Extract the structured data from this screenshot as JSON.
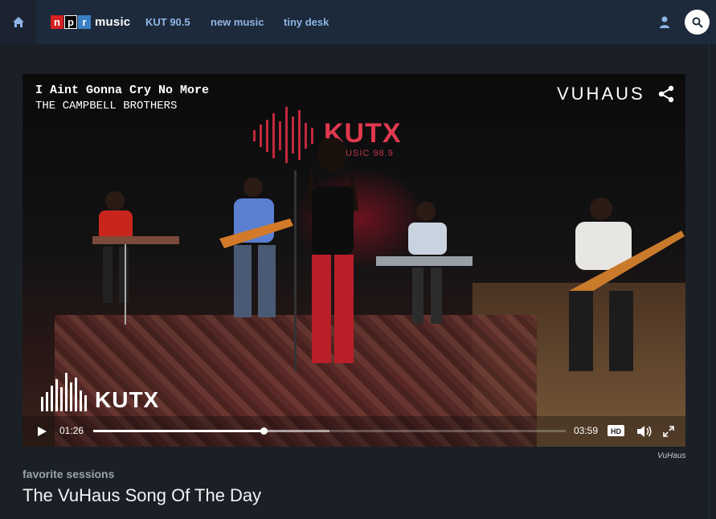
{
  "header": {
    "logo": {
      "n": "n",
      "p": "p",
      "r": "r",
      "music": "music"
    },
    "nav": [
      "KUT 90.5",
      "new music",
      "tiny desk"
    ],
    "icons": {
      "home": "home-icon",
      "user": "user-icon",
      "search": "search-icon"
    }
  },
  "video": {
    "song_title": "I Aint Gonna Cry No More",
    "artist": "THE CAMPBELL BROTHERS",
    "brand": "VUHAUS",
    "backdrop_sign": "KUTX",
    "backdrop_sub": "MUSIC 98.9",
    "watermark": "KUTX",
    "player": {
      "current_time": "01:26",
      "duration": "03:59",
      "progress_fraction": 0.36,
      "buffered_fraction": 0.5,
      "hd_label": "HD"
    }
  },
  "credit": "VuHaus",
  "section_label": "favorite sessions",
  "page_title": "The VuHaus Song Of The Day",
  "colors": {
    "topbar": "#1d2a3b",
    "nav_link": "#8fb5e6",
    "background": "#1b2027"
  }
}
